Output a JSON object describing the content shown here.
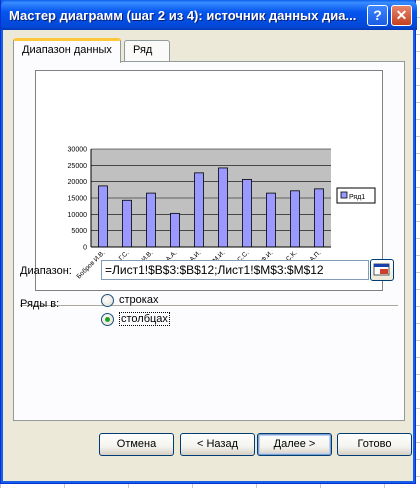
{
  "window": {
    "title": "Мастер диаграмм (шаг 2 из 4): источник данных диа...",
    "help_glyph": "?",
    "close_glyph": "✕"
  },
  "tabs": [
    {
      "label": "Диапазон данных"
    },
    {
      "label": "Ряд"
    }
  ],
  "range": {
    "label": "Диапазон:",
    "value": "=Лист1!$B$3:$B$12;Лист1!$M$3:$M$12"
  },
  "series_in": {
    "label": "Ряды в:",
    "options": [
      "строках",
      "столбцах"
    ],
    "selected": "столбцах"
  },
  "buttons": {
    "cancel": "Отмена",
    "back": "< Назад",
    "next": "Далее >",
    "finish": "Готово"
  },
  "chart_data": {
    "type": "bar",
    "categories": [
      "Бобров И.В.",
      "Зайцев Г.С.",
      "Иванов И.В.",
      "Климов А.А.",
      "Козлов А.И.",
      "Котов М.И.",
      "Кротов С.С.",
      "Утин Ф.И.",
      "Ухов С.К.",
      "Фролов А.П."
    ],
    "series": [
      {
        "name": "Ряд1",
        "values": [
          18700,
          14300,
          16500,
          10300,
          22700,
          24200,
          20700,
          16500,
          17200,
          17800
        ]
      }
    ],
    "yticks": [
      "0",
      "5000",
      "10000",
      "15000",
      "20000",
      "25000",
      "30000"
    ],
    "ylim": [
      0,
      30000
    ],
    "grid": true,
    "legend": "right",
    "colors": {
      "bar": "#9999ff",
      "plot_bg": "#c0c0c0"
    }
  }
}
